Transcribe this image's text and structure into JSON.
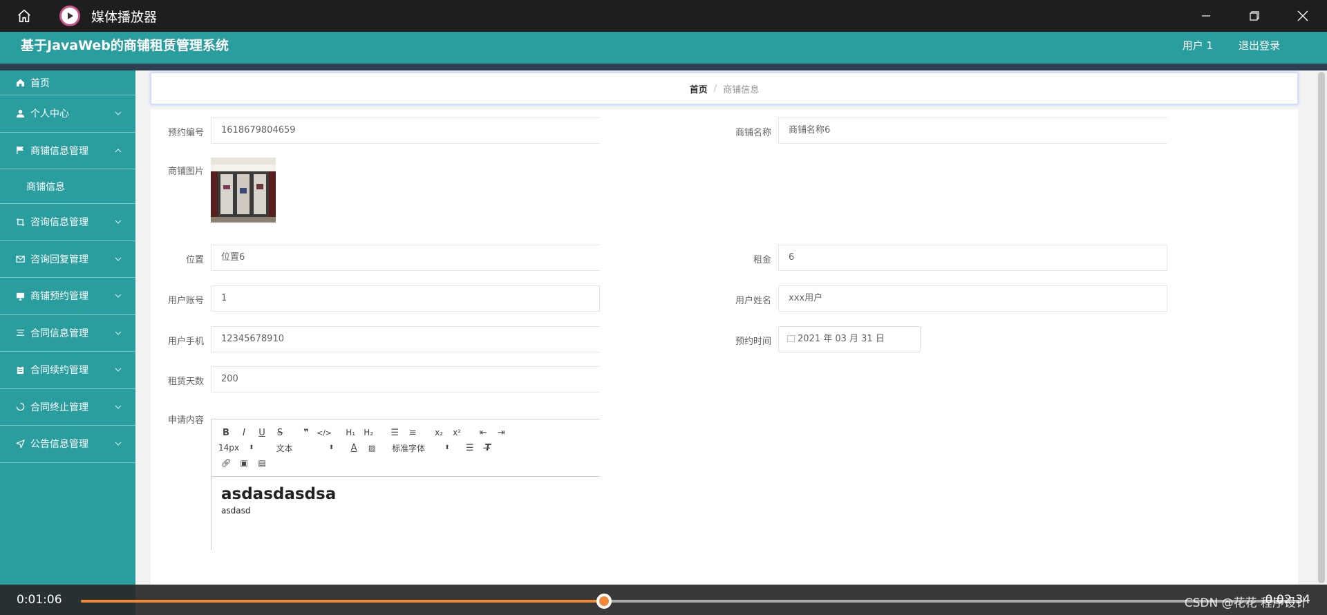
{
  "player": {
    "title": "媒体播放器",
    "current_time": "0:01:06",
    "duration": "0:02:34",
    "progress": 0.4286
  },
  "app": {
    "title": "基于JavaWeb的商铺租赁管理系统",
    "user": "用户 1",
    "logout": "退出登录"
  },
  "sidebar": {
    "items": [
      {
        "label": "首页",
        "icon": "home-icon"
      },
      {
        "label": "个人中心",
        "icon": "user-icon"
      },
      {
        "label": "商铺信息管理",
        "icon": "flag-icon"
      },
      {
        "label": "咨询信息管理",
        "icon": "crop-icon"
      },
      {
        "label": "咨询回复管理",
        "icon": "mail-icon"
      },
      {
        "label": "商铺预约管理",
        "icon": "monitor-icon"
      },
      {
        "label": "合同信息管理",
        "icon": "list-icon"
      },
      {
        "label": "合同续约管理",
        "icon": "clipboard-icon"
      },
      {
        "label": "合同终止管理",
        "icon": "loading-icon"
      },
      {
        "label": "公告信息管理",
        "icon": "send-icon"
      }
    ],
    "submenu": "商铺信息"
  },
  "breadcrumb": {
    "home": "首页",
    "sep": "/",
    "current": "商铺信息"
  },
  "form": {
    "booking_no_label": "预约编号",
    "booking_no": "1618679804659",
    "shop_name_label": "商铺名称",
    "shop_name": "商铺名称6",
    "shop_image_label": "商铺图片",
    "location_label": "位置",
    "location": "位置6",
    "rent_label": "租金",
    "rent": "6",
    "account_label": "用户账号",
    "account": "1",
    "username_label": "用户姓名",
    "username": "xxx用户",
    "phone_label": "用户手机",
    "phone": "12345678910",
    "time_label": "预约时间",
    "time": "2021 年 03 月 31 日",
    "days_label": "租赁天数",
    "days": "200",
    "content_label": "申请内容"
  },
  "editor": {
    "font_size": "14px",
    "paragraph": "文本",
    "font_family": "标准字体",
    "heading": "asdasdasdsa",
    "paragraph_text": "asdasd"
  },
  "watermark": "CSDN @花花 程序设计"
}
